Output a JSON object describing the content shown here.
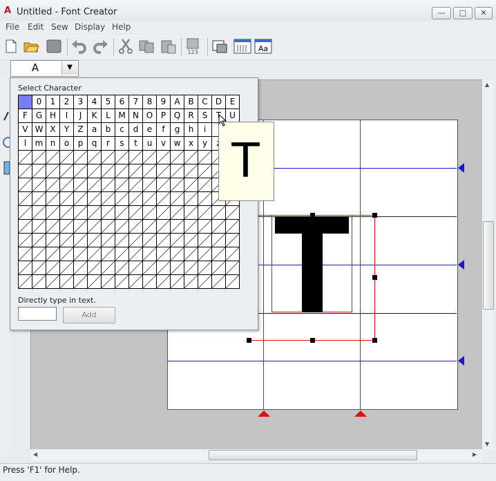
{
  "window": {
    "title": "Untitled - Font Creator"
  },
  "menu": [
    "File",
    "Edit",
    "Sew",
    "Display",
    "Help"
  ],
  "toolbar": {
    "icons": [
      "new-file-icon",
      "open-folder-icon",
      "save-icon",
      "undo-icon",
      "redo-icon",
      "cut-icon",
      "copy-icon",
      "paste-icon",
      "numbering-icon",
      "select-region-icon",
      "display-grid-icon",
      "font-preview-icon"
    ],
    "font_preview_label": "Aa",
    "numbering_label": "123"
  },
  "character_select": {
    "value": "A"
  },
  "popup": {
    "title": "Select Character",
    "rows": [
      [
        " ",
        "0",
        "1",
        "2",
        "3",
        "4",
        "5",
        "6",
        "7",
        "8",
        "9",
        "A",
        "B",
        "C",
        "D",
        "E"
      ],
      [
        "F",
        "G",
        "H",
        "I",
        "J",
        "K",
        "L",
        "M",
        "N",
        "O",
        "P",
        "Q",
        "R",
        "S",
        "T",
        "U"
      ],
      [
        "V",
        "W",
        "X",
        "Y",
        "Z",
        "a",
        "b",
        "c",
        "d",
        "e",
        "f",
        "g",
        "h",
        "i",
        "",
        ""
      ],
      [
        "l",
        "m",
        "n",
        "o",
        "p",
        "q",
        "r",
        "s",
        "t",
        "u",
        "v",
        "w",
        "x",
        "y",
        "z",
        ""
      ]
    ],
    "empty_rows": 10,
    "direct_label": "Directly type in text.",
    "direct_value": "",
    "add_label": "Add"
  },
  "preview": {
    "char": "T"
  },
  "status": {
    "text": "Press 'F1' for Help."
  },
  "colors": {
    "guide_blue": "#1a1acc",
    "guide_red": "#e01010",
    "selection": "#7b7bf5"
  }
}
